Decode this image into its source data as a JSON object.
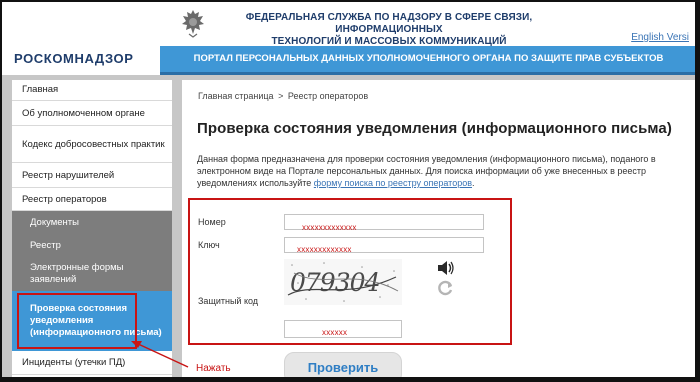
{
  "header": {
    "agency_line1": "ФЕДЕРАЛЬНАЯ СЛУЖБА ПО НАДЗОРУ В СФЕРЕ СВЯЗИ, ИНФОРМАЦИОННЫХ",
    "agency_line2": "ТЕХНОЛОГИЙ И МАССОВЫХ КОММУНИКАЦИЙ",
    "english_link": "English Versi",
    "logo": "РОСКОМНАДЗОР",
    "banner": "ПОРТАЛ ПЕРСОНАЛЬНЫХ ДАННЫХ УПОЛНОМОЧЕННОГО ОРГАНА ПО ЗАЩИТЕ ПРАВ СУБЪЕКТОВ ПЕРСОНАЛЬНЫХ ДАННЫХ"
  },
  "sidebar": {
    "items": [
      {
        "label": "Главная"
      },
      {
        "label": "Об уполномоченном органе"
      },
      {
        "label": "Кодекс добросовестных практик"
      },
      {
        "label": "Реестр нарушителей"
      },
      {
        "label": "Реестр операторов"
      },
      {
        "label": "Документы"
      },
      {
        "label": "Реестр"
      },
      {
        "label": "Электронные формы заявлений"
      },
      {
        "label": "Проверка состояния уведомления (информационного письма)"
      },
      {
        "label": "Инциденты (утечки ПД)"
      }
    ]
  },
  "breadcrumb": {
    "home": "Главная страница",
    "separator": ">",
    "current": "Реестр операторов"
  },
  "page": {
    "title": "Проверка состояния уведомления (информационного письма)",
    "description": "Данная форма предназначена для проверки состояния уведомления (информационного письма), поданого в электронном виде на Портале персональных данных. Для поиска информации об уже внесенных в реестр уведомлениях используйте ",
    "description_link": "форму поиска по реестру операторов",
    "description_end": "."
  },
  "form": {
    "number_label": "Номер",
    "number_value": "xxxxxxxxxxxxx",
    "key_label": "Ключ",
    "key_value": "xxxxxxxxxxxxx",
    "captcha_label": "Защитный код",
    "captcha_text": "079304",
    "captcha_value": "xxxxxx",
    "submit_label": "Проверить"
  },
  "annotation": {
    "click_label": "Нажать"
  },
  "colors": {
    "brand_blue": "#3f97d6",
    "navy": "#1f3d6b",
    "highlight_red": "#c81414",
    "sub_menu_gray": "#7d7d7d"
  },
  "icons": [
    "emblem-icon",
    "speaker-icon",
    "refresh-icon",
    "arrow-annotation"
  ]
}
